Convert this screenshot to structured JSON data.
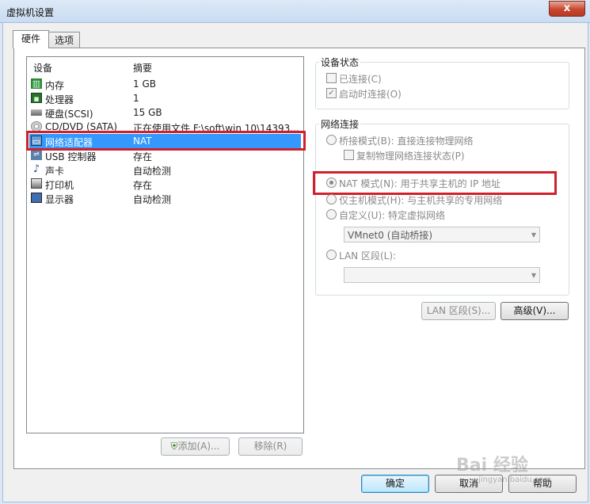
{
  "window": {
    "title": "虚拟机设置",
    "close_glyph": "x"
  },
  "tabs": [
    {
      "label": "硬件"
    },
    {
      "label": "选项"
    }
  ],
  "device_list": {
    "columns": {
      "device": "设备",
      "summary": "摘要"
    },
    "rows": [
      {
        "name": "内存",
        "summary": "1 GB",
        "icon": "memory-icon"
      },
      {
        "name": "处理器",
        "summary": "1",
        "icon": "processor-icon"
      },
      {
        "name": "硬盘(SCSI)",
        "summary": "15 GB",
        "icon": "hard-disk-icon"
      },
      {
        "name": "CD/DVD (SATA)",
        "summary": "正在使用文件 F:\\soft\\win 10\\14393...",
        "icon": "cd-dvd-icon"
      },
      {
        "name": "网络适配器",
        "summary": "NAT",
        "icon": "network-adapter-icon",
        "selected": true
      },
      {
        "name": "USB 控制器",
        "summary": "存在",
        "icon": "usb-icon"
      },
      {
        "name": "声卡",
        "summary": "自动检测",
        "icon": "sound-card-icon"
      },
      {
        "name": "打印机",
        "summary": "存在",
        "icon": "printer-icon"
      },
      {
        "name": "显示器",
        "summary": "自动检测",
        "icon": "display-icon"
      }
    ]
  },
  "list_buttons": {
    "add": "添加(A)...",
    "remove": "移除(R)"
  },
  "device_status": {
    "title": "设备状态",
    "connected": {
      "label": "已连接(C)",
      "checked": false
    },
    "connect_on_power_on": {
      "label": "启动时连接(O)",
      "checked": true
    }
  },
  "network_connection": {
    "title": "网络连接",
    "bridged": {
      "label": "桥接模式(B): 直接连接物理网络",
      "selected": false
    },
    "replicate": {
      "label": "复制物理网络连接状态(P)",
      "checked": false
    },
    "nat": {
      "label": "NAT 模式(N): 用于共享主机的 IP 地址",
      "selected": true
    },
    "host_only": {
      "label": "仅主机模式(H): 与主机共享的专用网络",
      "selected": false
    },
    "custom": {
      "label": "自定义(U): 特定虚拟网络",
      "selected": false
    },
    "custom_select": {
      "value": "VMnet0 (自动桥接)"
    },
    "lan_segment": {
      "label": "LAN 区段(L):",
      "selected": false
    },
    "lan_select": {
      "value": ""
    }
  },
  "right_buttons": {
    "lan_segments": "LAN 区段(S)...",
    "advanced": "高级(V)..."
  },
  "footer_buttons": {
    "ok": "确定",
    "cancel": "取消",
    "help": "帮助"
  },
  "watermark": {
    "brand": "Bai 经验",
    "url": "jingyan.baidu.com"
  },
  "colors": {
    "selection": "#3399ff",
    "highlight_box": "#d0202c",
    "accent": "#3c7fb1"
  }
}
